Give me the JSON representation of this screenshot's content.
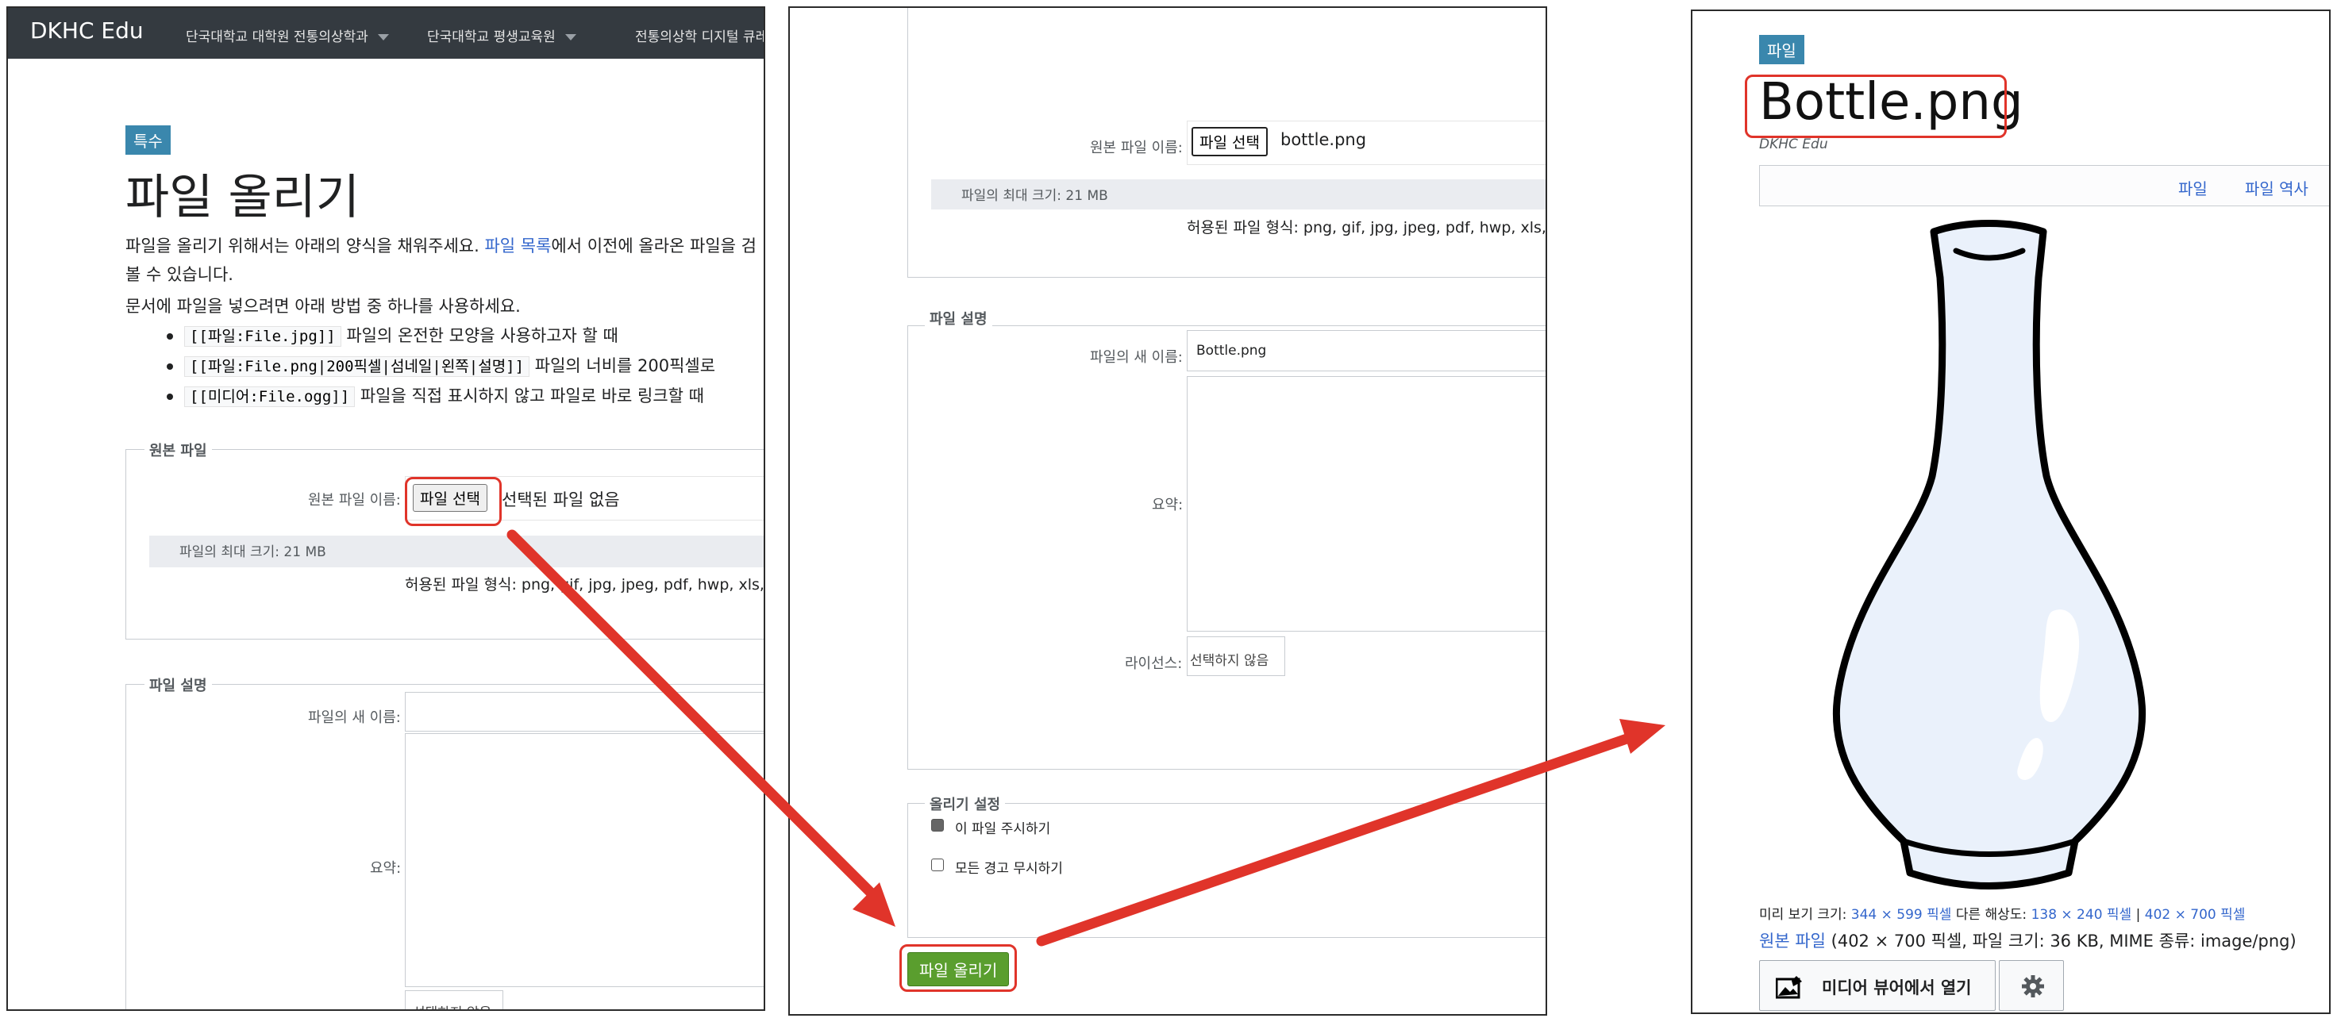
{
  "panel1": {
    "brand": "DKHC Edu",
    "nav": [
      "단국대학교 대학원 전통의상학과",
      "단국대학교 평생교육원",
      "전통의상학 디지털 큐레이"
    ],
    "badge": "특수",
    "title": "파일 올리기",
    "intro_before_link": "파일을 올리기 위해서는 아래의 양식을 채워주세요. ",
    "intro_link": "파일 목록",
    "intro_after_link": "에서 이전에 올라온 파일을 검",
    "intro_line2": "볼 수 있습니다.",
    "usage_intro": "문서에 파일을 넣으려면 아래 방법 중 하나를 사용하세요.",
    "usages": [
      {
        "code": "[[파일:File.jpg]]",
        "text": "파일의 온전한 모양을 사용하고자 할 때"
      },
      {
        "code": "[[파일:File.png|200픽셀|섬네일|왼쪽|설명]]",
        "text": "파일의 너비를 200픽셀로"
      },
      {
        "code": "[[미디어:File.ogg]]",
        "text": "파일을 직접 표시하지 않고 파일로 바로 링크할 때"
      }
    ],
    "source_legend": "원본 파일",
    "source_label": "원본 파일 이름:",
    "choose_file": "파일 선택",
    "no_file": "선택된 파일 없음",
    "max_size": "파일의 최대 크기: 21 MB",
    "allowed_types": "허용된 파일 형식: png, gif, jpg, jpeg, pdf, hwp, xls, x",
    "desc_legend": "파일 설명",
    "new_name_label": "파일의 새 이름:",
    "summary_label": "요약:",
    "license_value": "선택하지 않음"
  },
  "panel2": {
    "source_label": "원본 파일 이름:",
    "choose_file": "파일 선택",
    "file_name": "bottle.png",
    "max_size": "파일의 최대 크기: 21 MB",
    "allowed_types": "허용된 파일 형식: png, gif, jpg, jpeg, pdf, hwp, xls, x",
    "desc_legend": "파일 설명",
    "new_name_label": "파일의 새 이름:",
    "new_name_value": "Bottle.png",
    "summary_label": "요약:",
    "license_label": "라이선스:",
    "license_value": "선택하지 않음",
    "options_legend": "올리기 설정",
    "watch_label": "이 파일 주시하기",
    "watch_checked": true,
    "ignore_label": "모든 경고 무시하기",
    "ignore_checked": false,
    "upload_button": "파일 올리기"
  },
  "panel3": {
    "badge": "파일",
    "title": "Bottle.png",
    "site": "DKHC Edu",
    "tabs": [
      "파일",
      "파일 역사"
    ],
    "preview_label": "미리 보기 크기: ",
    "preview_link": "344 × 599 픽셀",
    "other_res_label": " 다른 해상도: ",
    "res1": "138 × 240 픽셀",
    "sep": " | ",
    "res2": "402 × 700 픽셀",
    "orig_link": "원본 파일",
    "orig_info": " (402 × 700 픽셀, 파일 크기: 36 KB, MIME 종류: image/png)",
    "viewer_button": "미디어 뷰어에서 열기"
  },
  "icons": [
    "dropdown-caret-icon",
    "image-edit-icon",
    "gear-icon"
  ],
  "colors": {
    "navbar": "#343a40",
    "badge": "#3a87ad",
    "link": "#3366cc",
    "highlight": "#e0342a",
    "upload_button": "#5a9e2e"
  }
}
